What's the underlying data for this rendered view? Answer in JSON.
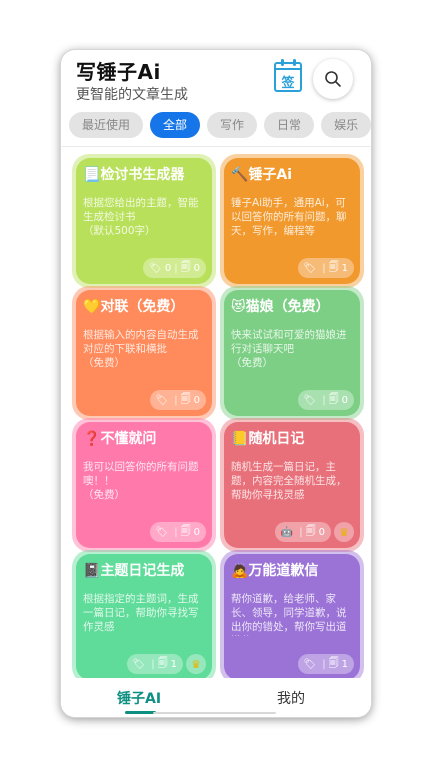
{
  "header": {
    "title": "写锤子Ai",
    "subtitle": "更智能的文章生成",
    "sign_label": "签"
  },
  "chips": [
    {
      "label": "最近使用",
      "active": false
    },
    {
      "label": "全部",
      "active": true
    },
    {
      "label": "写作",
      "active": false
    },
    {
      "label": "日常",
      "active": false
    },
    {
      "label": "娱乐",
      "active": false
    }
  ],
  "cards": [
    {
      "icon": "📃",
      "title": "检讨书生成器",
      "desc": "根据您给出的主题，智能生成检讨书",
      "note": "（默认500字）",
      "comments": "0",
      "copies": "0",
      "color": "#b8e05a",
      "crown": false,
      "robot": false
    },
    {
      "icon": "🔨",
      "title": "锤子Ai",
      "desc": "锤子Ai助手，通用Ai，可以回答你的所有问题，聊天，写作，编程等",
      "note": "",
      "comments": "",
      "copies": "1",
      "color": "#f29a2e",
      "crown": false,
      "robot": false
    },
    {
      "icon": "💛",
      "title": "对联（免费）",
      "desc": "根据输入的内容自动生成对应的下联和横批",
      "note": "（免费）",
      "comments": "",
      "copies": "0",
      "color": "#ff8a5b",
      "crown": false,
      "robot": false
    },
    {
      "icon": "😻",
      "title": "猫娘（免费）",
      "desc": "快来试试和可爱的猫娘进行对话聊天吧",
      "note": "（免费）",
      "comments": "",
      "copies": "0",
      "color": "#7dcf86",
      "crown": false,
      "robot": false
    },
    {
      "icon": "❓",
      "title": "不懂就问",
      "desc": "我可以回答你的所有问题噢！！",
      "note": "（免费）",
      "comments": "",
      "copies": "0",
      "color": "#ff7bab",
      "crown": false,
      "robot": false
    },
    {
      "icon": "📒",
      "title": "随机日记",
      "desc": "随机生成一篇日记，主题，内容完全随机生成，帮助你寻找灵感",
      "note": "",
      "comments": "",
      "copies": "0",
      "color": "#e8707a",
      "crown": true,
      "robot": true
    },
    {
      "icon": "📓",
      "title": "主题日记生成",
      "desc": "根据指定的主题词，生成一篇日记，帮助你寻找写作灵感",
      "note": "",
      "comments": "",
      "copies": "1",
      "color": "#5fdc9a",
      "crown": true,
      "robot": false
    },
    {
      "icon": "🙇",
      "title": "万能道歉信",
      "desc": "帮你道歉，给老师、家长、领导，同学道歉，说出你的错处，帮你写出道歉信",
      "note": "",
      "comments": "",
      "copies": "1",
      "color": "#9b73d8",
      "crown": false,
      "robot": false
    }
  ],
  "tabbar": {
    "home_label": "锤子AI",
    "me_label": "我的"
  },
  "colors": {
    "accent": "#1675e8",
    "tab_active": "#0f8f82"
  }
}
